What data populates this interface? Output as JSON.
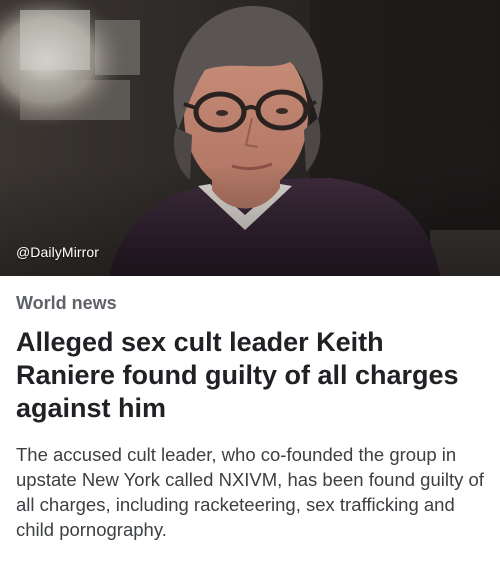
{
  "article": {
    "image_credit": "@DailyMirror",
    "category": "World news",
    "headline": "Alleged sex cult leader Keith Raniere found guilty of all charges against him",
    "summary": "The accused cult leader, who co-founded the group in upstate New York called NXIVM, has been found guilty of all charges, including racketeering, sex trafficking and child pornography."
  }
}
